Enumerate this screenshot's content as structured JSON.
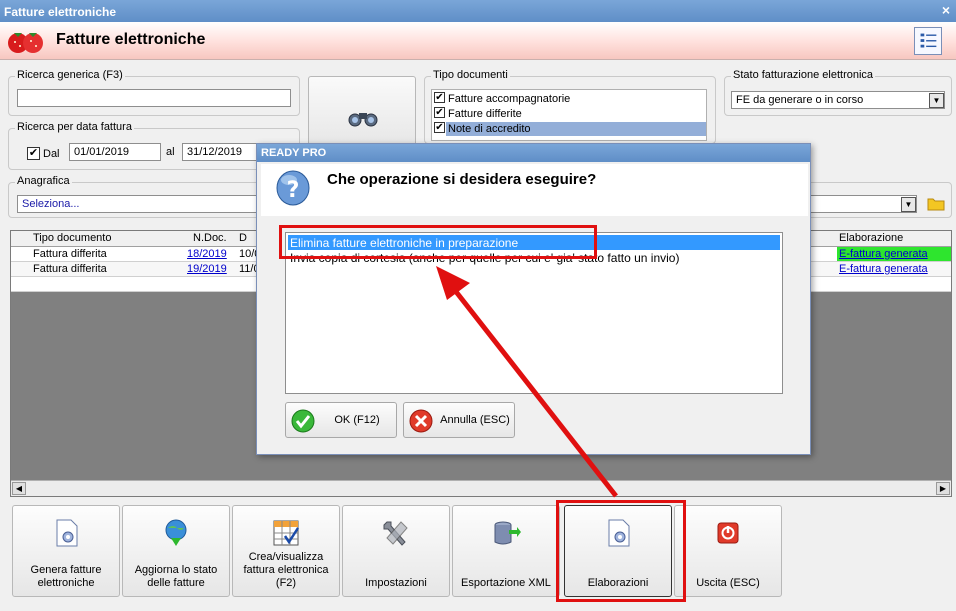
{
  "window": {
    "title": "Fatture elettroniche",
    "close_glyph": "×"
  },
  "header": {
    "title": "Fatture elettroniche",
    "logo_icon": "strawberry-icon",
    "menu_icon": "list-menu-icon"
  },
  "search": {
    "generic_legend": "Ricerca generica (F3)",
    "generic_value": "",
    "date_legend": "Ricerca per data fattura",
    "dal_label": "Dal",
    "dal_checked": true,
    "date_from": "01/01/2019",
    "al_label": "al",
    "date_to": "31/12/2019",
    "button_icon": "binoculars-icon"
  },
  "tipo_documenti": {
    "legend": "Tipo documenti",
    "items": [
      {
        "label": "Fatture accompagnatorie",
        "checked": true
      },
      {
        "label": "Fatture differite",
        "checked": true
      },
      {
        "label": "Note di accredito",
        "checked": true
      }
    ]
  },
  "stato": {
    "legend": "Stato fatturazione elettronica",
    "value": "FE da generare o in corso"
  },
  "anagrafica": {
    "legend": "Anagrafica",
    "value": "Seleziona..."
  },
  "grid": {
    "columns": [
      "Tipo documento",
      "N.Doc.",
      "D",
      "Elaborazione"
    ],
    "rows": [
      {
        "tipo": "Fattura differita",
        "ndoc": "18/2019",
        "data": "10/0",
        "elab": "E-fattura generata"
      },
      {
        "tipo": "Fattura differita",
        "ndoc": "19/2019",
        "data": "11/0",
        "elab": "E-fattura generata"
      }
    ]
  },
  "toolbar": {
    "buttons": [
      {
        "label": "Genera fatture elettroniche",
        "icon": "document-gear-icon"
      },
      {
        "label": "Aggiorna lo stato delle fatture",
        "icon": "globe-download-icon"
      },
      {
        "label": "Crea/visualizza fattura elettronica (F2)",
        "icon": "grid-check-icon"
      },
      {
        "label": "Impostazioni",
        "icon": "wrench-icon"
      },
      {
        "label": "Esportazione XML",
        "icon": "database-export-icon"
      },
      {
        "label": "Elaborazioni",
        "icon": "document-gear-icon"
      },
      {
        "label": "Uscita (ESC)",
        "icon": "power-icon"
      }
    ]
  },
  "dialog": {
    "title": "READY PRO",
    "question": "Che operazione si desidera eseguire?",
    "question_icon": "question-icon",
    "options": [
      "Elimina fatture elettroniche in preparazione",
      "Invia copia di cortesia (anche per quelle per cui e' gia' stato fatto un invio)"
    ],
    "selected_index": 0,
    "ok_label": "OK (F12)",
    "cancel_label": "Annulla (ESC)"
  },
  "colors": {
    "titlebar": "#6f9ad0",
    "annotation": "#e01010",
    "selection": "#3399ff",
    "status_ok": "#2ee52e"
  }
}
